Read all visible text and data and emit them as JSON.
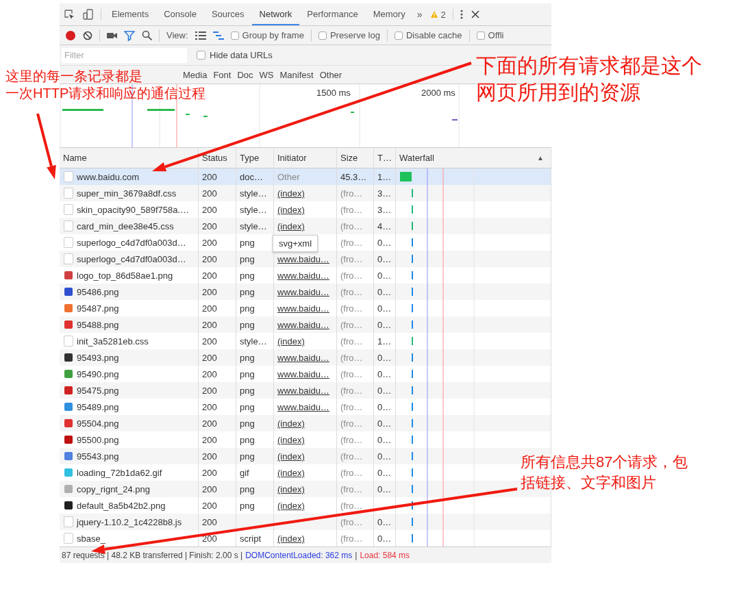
{
  "tabs": [
    {
      "label": "Elements",
      "selected": false
    },
    {
      "label": "Console",
      "selected": false
    },
    {
      "label": "Sources",
      "selected": false
    },
    {
      "label": "Network",
      "selected": true
    },
    {
      "label": "Performance",
      "selected": false
    },
    {
      "label": "Memory",
      "selected": false
    }
  ],
  "more_tabs": "»",
  "warnings": "2",
  "toolbar": {
    "recording": true,
    "filter_active": true,
    "view_label": "View:",
    "views": [
      {
        "kind": "list",
        "selected": false
      },
      {
        "kind": "waterfall",
        "selected": true
      }
    ],
    "checkboxes": [
      {
        "label": "Group by frame",
        "checked": false
      },
      {
        "label": "Preserve log",
        "checked": false
      },
      {
        "label": "Disable cache",
        "checked": false
      },
      {
        "label": "Offli",
        "checked": false
      }
    ]
  },
  "filter": {
    "placeholder": "Filter"
  },
  "hide_data_urls": {
    "label": "Hide data URLs",
    "checked": false
  },
  "resource_types": [
    "Media",
    "Font",
    "Doc",
    "WS",
    "Manifest",
    "Other"
  ],
  "overview_ticks": [
    "1500 ms",
    "2000 ms"
  ],
  "columns": [
    "Name",
    "Status",
    "Type",
    "Initiator",
    "Size",
    "T…",
    "Waterfall"
  ],
  "sort_indicator": "▲",
  "rows": [
    {
      "name": "www.baidu.com",
      "status": "200",
      "type": "doc…",
      "initiator": "Other",
      "initiator_link": false,
      "size": "45.3…",
      "cached": false,
      "time": "1…",
      "kind": "document",
      "selected": true
    },
    {
      "name": "super_min_3679a8df.css",
      "status": "200",
      "type": "style…",
      "initiator": "(index)",
      "initiator_link": true,
      "size": "(fro…",
      "cached": true,
      "time": "3…",
      "kind": "stylesheet",
      "selected": false
    },
    {
      "name": "skin_opacity90_589f758a.…",
      "status": "200",
      "type": "style…",
      "initiator": "(index)",
      "initiator_link": true,
      "size": "(fro…",
      "cached": true,
      "time": "3…",
      "kind": "stylesheet",
      "selected": false
    },
    {
      "name": "card_min_dee38e45.css",
      "status": "200",
      "type": "style…",
      "initiator": "(index)",
      "initiator_link": true,
      "size": "(fro…",
      "cached": true,
      "time": "4…",
      "kind": "stylesheet",
      "selected": false
    },
    {
      "name": "superlogo_c4d7df0a003d…",
      "status": "200",
      "type": "png",
      "size": "(fro…",
      "cached": true,
      "time": "0…",
      "kind": "image",
      "selected": false
    },
    {
      "name": "superlogo_c4d7df0a003d…",
      "status": "200",
      "type": "png",
      "initiator": "www.baidu…",
      "initiator_link": true,
      "size": "(fro…",
      "cached": true,
      "time": "0…",
      "kind": "image",
      "selected": false
    },
    {
      "name": "logo_top_86d58ae1.png",
      "status": "200",
      "type": "png",
      "initiator": "www.baidu…",
      "initiator_link": true,
      "size": "(fro…",
      "cached": true,
      "time": "0…",
      "kind": "image",
      "color": "#d04040",
      "selected": false
    },
    {
      "name": "95486.png",
      "status": "200",
      "type": "png",
      "initiator": "www.baidu…",
      "initiator_link": true,
      "size": "(fro…",
      "cached": true,
      "time": "0…",
      "kind": "image",
      "color": "#3050d0",
      "selected": false
    },
    {
      "name": "95487.png",
      "status": "200",
      "type": "png",
      "initiator": "www.baidu…",
      "initiator_link": true,
      "size": "(fro…",
      "cached": true,
      "time": "0…",
      "kind": "image",
      "color": "#f07030",
      "selected": false
    },
    {
      "name": "95488.png",
      "status": "200",
      "type": "png",
      "initiator": "www.baidu…",
      "initiator_link": true,
      "size": "(fro…",
      "cached": true,
      "time": "0…",
      "kind": "image",
      "color": "#e03030",
      "selected": false
    },
    {
      "name": "init_3a5281eb.css",
      "status": "200",
      "type": "style…",
      "initiator": "(index)",
      "initiator_link": true,
      "size": "(fro…",
      "cached": true,
      "time": "1…",
      "kind": "stylesheet",
      "selected": false
    },
    {
      "name": "95493.png",
      "status": "200",
      "type": "png",
      "initiator": "www.baidu…",
      "initiator_link": true,
      "size": "(fro…",
      "cached": true,
      "time": "0…",
      "kind": "image",
      "color": "#303030",
      "selected": false
    },
    {
      "name": "95490.png",
      "status": "200",
      "type": "png",
      "initiator": "www.baidu…",
      "initiator_link": true,
      "size": "(fro…",
      "cached": true,
      "time": "0…",
      "kind": "image",
      "color": "#40a040",
      "selected": false
    },
    {
      "name": "95475.png",
      "status": "200",
      "type": "png",
      "initiator": "www.baidu…",
      "initiator_link": true,
      "size": "(fro…",
      "cached": true,
      "time": "0…",
      "kind": "image",
      "color": "#d02020",
      "selected": false
    },
    {
      "name": "95489.png",
      "status": "200",
      "type": "png",
      "initiator": "www.baidu…",
      "initiator_link": true,
      "size": "(fro…",
      "cached": true,
      "time": "0…",
      "kind": "image",
      "color": "#3090e0",
      "selected": false
    },
    {
      "name": "95504.png",
      "status": "200",
      "type": "png",
      "initiator": "(index)",
      "initiator_link": true,
      "size": "(fro…",
      "cached": true,
      "time": "0…",
      "kind": "image",
      "color": "#e03030",
      "selected": false
    },
    {
      "name": "95500.png",
      "status": "200",
      "type": "png",
      "initiator": "(index)",
      "initiator_link": true,
      "size": "(fro…",
      "cached": true,
      "time": "0…",
      "kind": "image",
      "color": "#c01010",
      "selected": false
    },
    {
      "name": "95543.png",
      "status": "200",
      "type": "png",
      "initiator": "(index)",
      "initiator_link": true,
      "size": "(fro…",
      "cached": true,
      "time": "0…",
      "kind": "image",
      "color": "#5080e0",
      "selected": false
    },
    {
      "name": "loading_72b1da62.gif",
      "status": "200",
      "type": "gif",
      "initiator": "(index)",
      "initiator_link": true,
      "size": "(fro…",
      "cached": true,
      "time": "0…",
      "kind": "image",
      "color": "#30c0e0",
      "selected": false
    },
    {
      "name": "copy_rignt_24.png",
      "status": "200",
      "type": "png",
      "initiator": "(index)",
      "initiator_link": true,
      "size": "(fro…",
      "cached": true,
      "time": "0…",
      "kind": "image",
      "color": "#b0b0b0",
      "selected": false
    },
    {
      "name": "default_8a5b42b2.png",
      "status": "200",
      "type": "png",
      "initiator": "(index)",
      "initiator_link": true,
      "size": "(fro…",
      "cached": true,
      "kind": "image",
      "color": "#202020",
      "selected": false
    },
    {
      "name": "jquery-1.10.2_1c4228b8.js",
      "status": "200",
      "size": "(fro…",
      "cached": true,
      "time": "0…",
      "kind": "script",
      "selected": false
    },
    {
      "name": "sbase_",
      "status": "200",
      "type": "script",
      "initiator": "(index)",
      "initiator_link": true,
      "size": "(fro…",
      "cached": true,
      "time": "0…",
      "kind": "script",
      "selected": false
    }
  ],
  "tooltip": "svg+xml",
  "status_bar": [
    {
      "text": "87 requests | 48.2 KB transferred | Finish: 2.00 s |",
      "kind": "summary"
    },
    {
      "text": "DOMContentLoaded: 362 ms",
      "kind": "domcontentloaded"
    },
    {
      "text": "|",
      "kind": "separator"
    },
    {
      "text": "Load: 584 ms",
      "kind": "load"
    }
  ],
  "annotations": [
    {
      "lines": [
        "这里的每一条记录都是",
        "一次HTTP请求和响应的通信过程"
      ],
      "kind": "small"
    },
    {
      "lines": [
        "下面的所有请求都是这个",
        "网页所用到的资源"
      ],
      "kind": "large"
    },
    {
      "lines": [
        "所有信息共87个请求，包",
        "括链接、文字和图片"
      ],
      "kind": "medium"
    }
  ]
}
